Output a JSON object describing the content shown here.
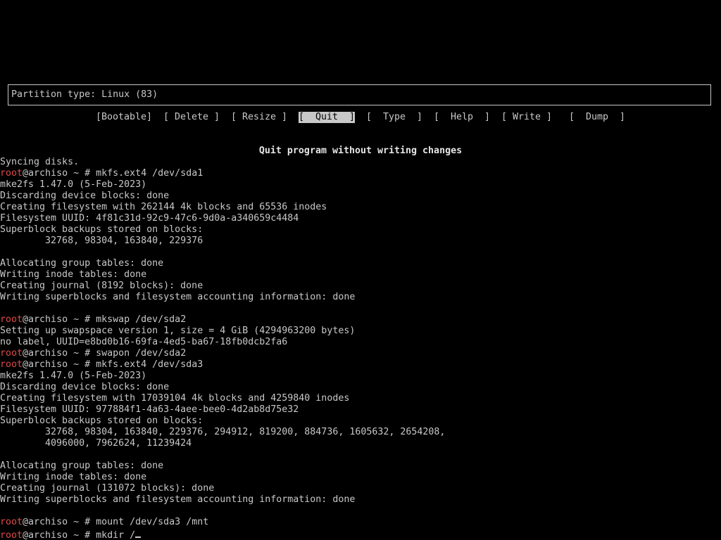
{
  "partition_type": "Partition type: Linux (83)",
  "menu": {
    "bootable": "[Bootable]",
    "delete": "[ Delete ]",
    "resize": "[ Resize ]",
    "quit": "[  Quit  ]",
    "type": "[  Type  ]",
    "help": "[  Help  ]",
    "write": "[ Write ]",
    "dump": "[  Dump  ]",
    "selected": "quit"
  },
  "hint": "Quit program without writing changes",
  "prompt": {
    "user": "root",
    "host_path": "@archiso ~ # "
  },
  "terminal": {
    "l0": "Syncing disks.",
    "c1": "mkfs.ext4 /dev/sda1",
    "l2": "mke2fs 1.47.0 (5-Feb-2023)",
    "l3": "Discarding device blocks: done",
    "l4": "Creating filesystem with 262144 4k blocks and 65536 inodes",
    "l5": "Filesystem UUID: 4f81c31d-92c9-47c6-9d0a-a340659c4484",
    "l6": "Superblock backups stored on blocks:",
    "l7": "        32768, 98304, 163840, 229376",
    "l9": "Allocating group tables: done",
    "l10": "Writing inode tables: done",
    "l11": "Creating journal (8192 blocks): done",
    "l12": "Writing superblocks and filesystem accounting information: done",
    "c14": "mkswap /dev/sda2",
    "l15": "Setting up swapspace version 1, size = 4 GiB (4294963200 bytes)",
    "l16": "no label, UUID=e8bd0b16-69fa-4ed5-ba67-18fb0dcb2fa6",
    "c17": "swapon /dev/sda2",
    "c18": "mkfs.ext4 /dev/sda3",
    "l19": "mke2fs 1.47.0 (5-Feb-2023)",
    "l20": "Discarding device blocks: done",
    "l21": "Creating filesystem with 17039104 4k blocks and 4259840 inodes",
    "l22": "Filesystem UUID: 977884f1-4a63-4aee-bee0-4d2ab8d75e32",
    "l23": "Superblock backups stored on blocks:",
    "l24": "        32768, 98304, 163840, 229376, 294912, 819200, 884736, 1605632, 2654208,",
    "l25": "        4096000, 7962624, 11239424",
    "l27": "Allocating group tables: done",
    "l28": "Writing inode tables: done",
    "l29": "Creating journal (131072 blocks): done",
    "l30": "Writing superblocks and filesystem accounting information: done",
    "c32": "mount /dev/sda3 /mnt",
    "c33": "mkdir /"
  }
}
